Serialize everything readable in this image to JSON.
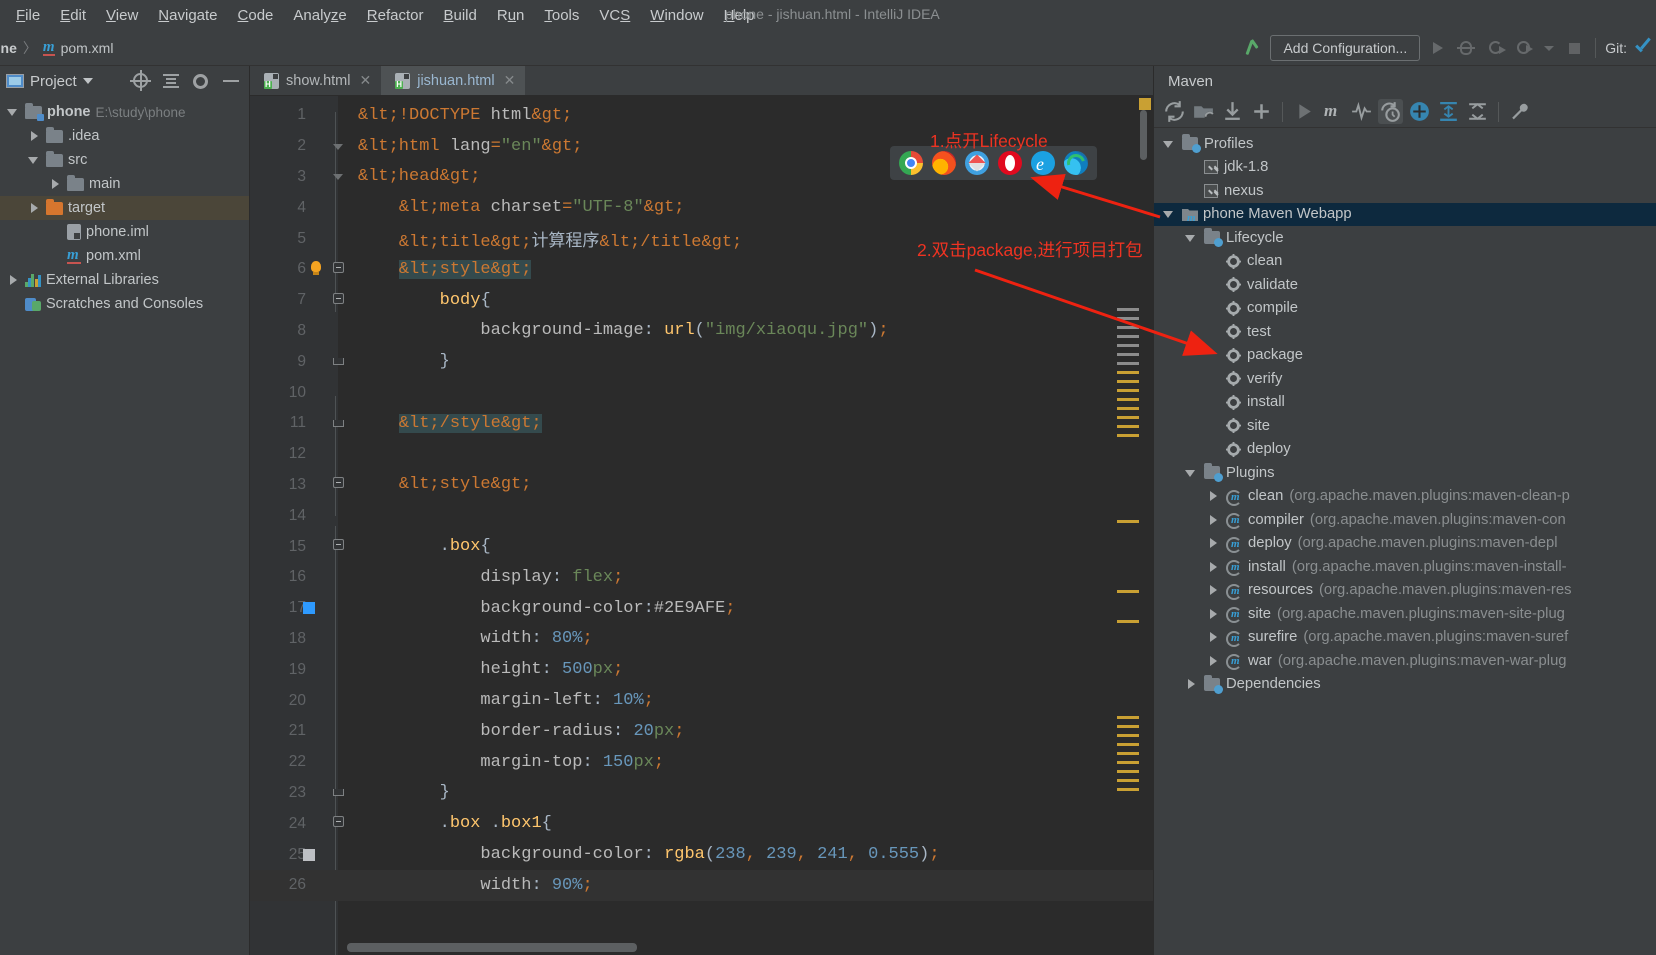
{
  "window": {
    "title": "phone - jishuan.html - IntelliJ IDEA"
  },
  "menubar": {
    "items": [
      {
        "label": "File",
        "mnemonic": "F"
      },
      {
        "label": "Edit",
        "mnemonic": "E"
      },
      {
        "label": "View",
        "mnemonic": "V"
      },
      {
        "label": "Navigate",
        "mnemonic": "N"
      },
      {
        "label": "Code",
        "mnemonic": "C"
      },
      {
        "label": "Analyze",
        "mnemonic": "z"
      },
      {
        "label": "Refactor",
        "mnemonic": "R"
      },
      {
        "label": "Build",
        "mnemonic": "B"
      },
      {
        "label": "Run",
        "mnemonic": "u"
      },
      {
        "label": "Tools",
        "mnemonic": "T"
      },
      {
        "label": "VCS",
        "mnemonic": "S"
      },
      {
        "label": "Window",
        "mnemonic": "W"
      },
      {
        "label": "Help",
        "mnemonic": "H"
      }
    ]
  },
  "toolbar": {
    "breadcrumb": {
      "project": "one",
      "separator": "〉",
      "file": "pom.xml"
    },
    "add_configuration": "Add Configuration...",
    "git_label": "Git:",
    "icons": [
      "run-icon",
      "debug-icon",
      "coverage-icon",
      "profile-icon",
      "stop-icon",
      "git-update-icon"
    ]
  },
  "project_panel": {
    "title": "Project",
    "header_icons": [
      "locate-icon",
      "collapse-all-icon",
      "settings-gear-icon",
      "minimize-icon"
    ],
    "tree": [
      {
        "label": "phone",
        "path": "E:\\study\\phone",
        "indent": 0,
        "twist": "open",
        "icon": "module-folder-icon",
        "bold": true,
        "selected": false
      },
      {
        "label": ".idea",
        "path": "",
        "indent": 1,
        "twist": "closed",
        "icon": "folder-icon",
        "bold": false,
        "selected": false
      },
      {
        "label": "src",
        "path": "",
        "indent": 1,
        "twist": "open",
        "icon": "folder-icon",
        "bold": false,
        "selected": false
      },
      {
        "label": "main",
        "path": "",
        "indent": 2,
        "twist": "closed",
        "icon": "folder-icon",
        "bold": false,
        "selected": false
      },
      {
        "label": "target",
        "path": "",
        "indent": 1,
        "twist": "closed",
        "icon": "folder-orange-icon",
        "bold": false,
        "selected": true
      },
      {
        "label": "phone.iml",
        "path": "",
        "indent": 2,
        "twist": "none",
        "icon": "iml-file-icon",
        "bold": false,
        "selected": false
      },
      {
        "label": "pom.xml",
        "path": "",
        "indent": 2,
        "twist": "none",
        "icon": "maven-pom-icon",
        "bold": false,
        "selected": false
      },
      {
        "label": "External Libraries",
        "path": "",
        "indent": 0,
        "twist": "closed",
        "icon": "libraries-icon",
        "bold": false,
        "selected": false
      },
      {
        "label": "Scratches and Consoles",
        "path": "",
        "indent": 0,
        "twist": "none",
        "icon": "scratches-icon",
        "bold": false,
        "selected": false
      }
    ]
  },
  "editor": {
    "tabs": [
      {
        "label": "show.html",
        "active": false,
        "icon": "html-file-icon"
      },
      {
        "label": "jishuan.html",
        "active": true,
        "icon": "html-file-icon"
      }
    ],
    "lines": [
      {
        "n": "1"
      },
      {
        "n": "2"
      },
      {
        "n": "3"
      },
      {
        "n": "4"
      },
      {
        "n": "5"
      },
      {
        "n": "6"
      },
      {
        "n": "7"
      },
      {
        "n": "8"
      },
      {
        "n": "9"
      },
      {
        "n": "10"
      },
      {
        "n": "11"
      },
      {
        "n": "12"
      },
      {
        "n": "13"
      },
      {
        "n": "14"
      },
      {
        "n": "15"
      },
      {
        "n": "16"
      },
      {
        "n": "17"
      },
      {
        "n": "18"
      },
      {
        "n": "19"
      },
      {
        "n": "20"
      },
      {
        "n": "21"
      },
      {
        "n": "22"
      },
      {
        "n": "23"
      },
      {
        "n": "24"
      },
      {
        "n": "25"
      },
      {
        "n": "26"
      }
    ],
    "code": {
      "l1": "<!DOCTYPE html>",
      "l2": "<html lang=\"en\">",
      "l3": "<head>",
      "l4": "<meta charset=\"UTF-8\">",
      "l5": "<title>计算程序</title>",
      "l6": "<style>",
      "l7": "body{",
      "l8": "background-image: url(\"img/xiaoqu.jpg\");",
      "l9": "}",
      "l11": "</style>",
      "l13": "<style>",
      "l15": ".box{",
      "l16": "display: flex;",
      "l17": "background-color:#2E9AFE;",
      "l18": "width: 80%;",
      "l19": "height: 500px;",
      "l20": "margin-left: 10%;",
      "l21": "border-radius: 20px;",
      "l22": "margin-top: 150px;",
      "l23": "}",
      "l24": ".box .box1{",
      "l25": "background-color: rgba(238, 239, 241, 0.555);",
      "l26": "width: 90%;"
    },
    "color_chips": [
      {
        "line": 17,
        "hex": "#2E9AFE"
      },
      {
        "line": 25,
        "hex": "#EEEFF1"
      }
    ]
  },
  "maven_panel": {
    "title": "Maven",
    "toolbar_icons": [
      "reload-icon",
      "add-managed-project-icon",
      "download-sources-icon",
      "add-icon",
      "execute-icon",
      "maven-goal-icon",
      "toggle-skip-tests-icon",
      "toggle-offline-icon",
      "show-dependencies-icon",
      "expand-all-icon",
      "collapse-all-icon",
      "settings-wrench-icon"
    ],
    "tree": [
      {
        "label": "Profiles",
        "indent": 0,
        "twist": "open",
        "icon": "profiles-folder-icon",
        "selected": false,
        "type": "folder"
      },
      {
        "label": "jdk-1.8",
        "indent": 1,
        "twist": "none",
        "icon": "checkbox-checked",
        "selected": false,
        "type": "check"
      },
      {
        "label": "nexus",
        "indent": 1,
        "twist": "none",
        "icon": "checkbox-checked",
        "selected": false,
        "type": "check"
      },
      {
        "label": "phone Maven Webapp",
        "indent": 0,
        "twist": "open",
        "icon": "maven-module-icon",
        "selected": true,
        "type": "module"
      },
      {
        "label": "Lifecycle",
        "indent": 1,
        "twist": "open",
        "icon": "lifecycle-folder-icon",
        "selected": false,
        "type": "folder"
      },
      {
        "label": "clean",
        "indent": 2,
        "twist": "none",
        "icon": "goal-gear-icon",
        "selected": false,
        "type": "goal"
      },
      {
        "label": "validate",
        "indent": 2,
        "twist": "none",
        "icon": "goal-gear-icon",
        "selected": false,
        "type": "goal"
      },
      {
        "label": "compile",
        "indent": 2,
        "twist": "none",
        "icon": "goal-gear-icon",
        "selected": false,
        "type": "goal"
      },
      {
        "label": "test",
        "indent": 2,
        "twist": "none",
        "icon": "goal-gear-icon",
        "selected": false,
        "type": "goal"
      },
      {
        "label": "package",
        "indent": 2,
        "twist": "none",
        "icon": "goal-gear-icon",
        "selected": false,
        "type": "goal"
      },
      {
        "label": "verify",
        "indent": 2,
        "twist": "none",
        "icon": "goal-gear-icon",
        "selected": false,
        "type": "goal"
      },
      {
        "label": "install",
        "indent": 2,
        "twist": "none",
        "icon": "goal-gear-icon",
        "selected": false,
        "type": "goal"
      },
      {
        "label": "site",
        "indent": 2,
        "twist": "none",
        "icon": "goal-gear-icon",
        "selected": false,
        "type": "goal"
      },
      {
        "label": "deploy",
        "indent": 2,
        "twist": "none",
        "icon": "goal-gear-icon",
        "selected": false,
        "type": "goal"
      },
      {
        "label": "Plugins",
        "indent": 1,
        "twist": "open",
        "icon": "plugins-folder-icon",
        "selected": false,
        "type": "folder"
      },
      {
        "label": "clean",
        "sub": "(org.apache.maven.plugins:maven-clean-p",
        "indent": 2,
        "twist": "closed",
        "icon": "plugin-icon",
        "selected": false,
        "type": "plugin"
      },
      {
        "label": "compiler",
        "sub": "(org.apache.maven.plugins:maven-con",
        "indent": 2,
        "twist": "closed",
        "icon": "plugin-icon",
        "selected": false,
        "type": "plugin"
      },
      {
        "label": "deploy",
        "sub": "(org.apache.maven.plugins:maven-depl",
        "indent": 2,
        "twist": "closed",
        "icon": "plugin-icon",
        "selected": false,
        "type": "plugin"
      },
      {
        "label": "install",
        "sub": "(org.apache.maven.plugins:maven-install-",
        "indent": 2,
        "twist": "closed",
        "icon": "plugin-icon",
        "selected": false,
        "type": "plugin"
      },
      {
        "label": "resources",
        "sub": "(org.apache.maven.plugins:maven-res",
        "indent": 2,
        "twist": "closed",
        "icon": "plugin-icon",
        "selected": false,
        "type": "plugin"
      },
      {
        "label": "site",
        "sub": "(org.apache.maven.plugins:maven-site-plug",
        "indent": 2,
        "twist": "closed",
        "icon": "plugin-icon",
        "selected": false,
        "type": "plugin"
      },
      {
        "label": "surefire",
        "sub": "(org.apache.maven.plugins:maven-suref",
        "indent": 2,
        "twist": "closed",
        "icon": "plugin-icon",
        "selected": false,
        "type": "plugin"
      },
      {
        "label": "war",
        "sub": "(org.apache.maven.plugins:maven-war-plug",
        "indent": 2,
        "twist": "closed",
        "icon": "plugin-icon",
        "selected": false,
        "type": "plugin"
      },
      {
        "label": "Dependencies",
        "indent": 1,
        "twist": "closed",
        "icon": "dependencies-folder-icon",
        "selected": false,
        "type": "folder"
      }
    ]
  },
  "annotations": {
    "note1": "1.点开Lifecycle",
    "note2": "2.双击package,进行项目打包",
    "color": "#ee3322"
  },
  "browser_popup": {
    "browsers": [
      "chrome-icon",
      "firefox-icon",
      "safari-icon",
      "opera-icon",
      "internet-explorer-icon",
      "edge-icon"
    ]
  }
}
